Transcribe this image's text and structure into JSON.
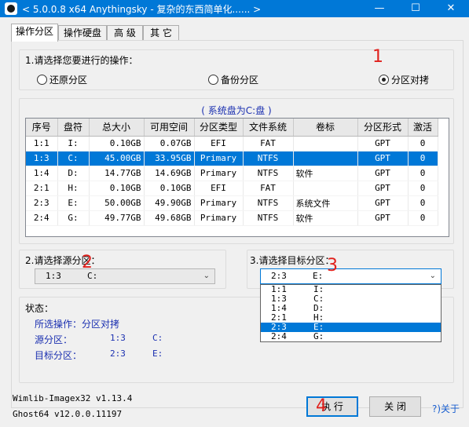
{
  "window": {
    "title": "< 5.0.0.8 x64 Anythingsky - 复杂的东西简单化...... >",
    "min_glyph": "—",
    "max_glyph": "☐",
    "close_glyph": "✕"
  },
  "tabs": [
    {
      "label": "操作分区",
      "active": true
    },
    {
      "label": "操作硬盘",
      "active": false
    },
    {
      "label": "高 级",
      "active": false
    },
    {
      "label": "其 它",
      "active": false
    }
  ],
  "operation": {
    "prompt": "1.请选择您要进行的操作：",
    "options": [
      {
        "label": "还原分区",
        "selected": false
      },
      {
        "label": "备份分区",
        "selected": false
      },
      {
        "label": "分区对拷",
        "selected": true
      }
    ]
  },
  "annotations": [
    "1",
    "2",
    "3",
    "4"
  ],
  "table": {
    "title": "( 系统盘为C:盘 )",
    "columns": [
      "序号",
      "盘符",
      "总大小",
      "可用空间",
      "分区类型",
      "文件系统",
      "卷标",
      "分区形式",
      "激活"
    ],
    "rows": [
      {
        "idx": "1:1",
        "drive": "I:",
        "total": "0.10GB",
        "free": "0.07GB",
        "ptype": "EFI",
        "fs": "FAT",
        "label": "",
        "style": "GPT",
        "active": "0",
        "selected": false
      },
      {
        "idx": "1:3",
        "drive": "C:",
        "total": "45.00GB",
        "free": "33.95GB",
        "ptype": "Primary",
        "fs": "NTFS",
        "label": "",
        "style": "GPT",
        "active": "0",
        "selected": true
      },
      {
        "idx": "1:4",
        "drive": "D:",
        "total": "14.77GB",
        "free": "14.69GB",
        "ptype": "Primary",
        "fs": "NTFS",
        "label": "软件",
        "style": "GPT",
        "active": "0",
        "selected": false
      },
      {
        "idx": "2:1",
        "drive": "H:",
        "total": "0.10GB",
        "free": "0.10GB",
        "ptype": "EFI",
        "fs": "FAT",
        "label": "",
        "style": "GPT",
        "active": "0",
        "selected": false
      },
      {
        "idx": "2:3",
        "drive": "E:",
        "total": "50.00GB",
        "free": "49.90GB",
        "ptype": "Primary",
        "fs": "NTFS",
        "label": "系统文件",
        "style": "GPT",
        "active": "0",
        "selected": false
      },
      {
        "idx": "2:4",
        "drive": "G:",
        "total": "49.77GB",
        "free": "49.68GB",
        "ptype": "Primary",
        "fs": "NTFS",
        "label": "软件",
        "style": "GPT",
        "active": "0",
        "selected": false
      }
    ]
  },
  "source": {
    "prompt": "2.请选择源分区：",
    "value_idx": "1:3",
    "value_drive": "C:"
  },
  "target": {
    "prompt": "3.请选择目标分区：",
    "value_idx": "2:3",
    "value_drive": "E:",
    "options": [
      {
        "idx": "1:1",
        "drive": "I:",
        "selected": false
      },
      {
        "idx": "1:3",
        "drive": "C:",
        "selected": false
      },
      {
        "idx": "1:4",
        "drive": "D:",
        "selected": false
      },
      {
        "idx": "2:1",
        "drive": "H:",
        "selected": false
      },
      {
        "idx": "2:3",
        "drive": "E:",
        "selected": true
      },
      {
        "idx": "2:4",
        "drive": "G:",
        "selected": false
      }
    ]
  },
  "status": {
    "heading": "状态：",
    "op_label": "所选操作：",
    "op_value": "分区对拷",
    "src_label": "源分区：",
    "src_idx": "1:3",
    "src_drive": "C:",
    "dst_label": "目标分区：",
    "dst_idx": "2:3",
    "dst_drive": "E:"
  },
  "versions": {
    "wimlib": "Wimlib-Imagex32 v1.13.4",
    "ghost": "Ghost64 v12.0.0.11197"
  },
  "buttons": {
    "execute": "执 行",
    "close": "关 闭",
    "about": "?)关于"
  },
  "colors": {
    "titlebar": "#0078d7",
    "selection": "#0078d7",
    "annotation": "#e0201c",
    "status_text": "#1a2fb0"
  }
}
